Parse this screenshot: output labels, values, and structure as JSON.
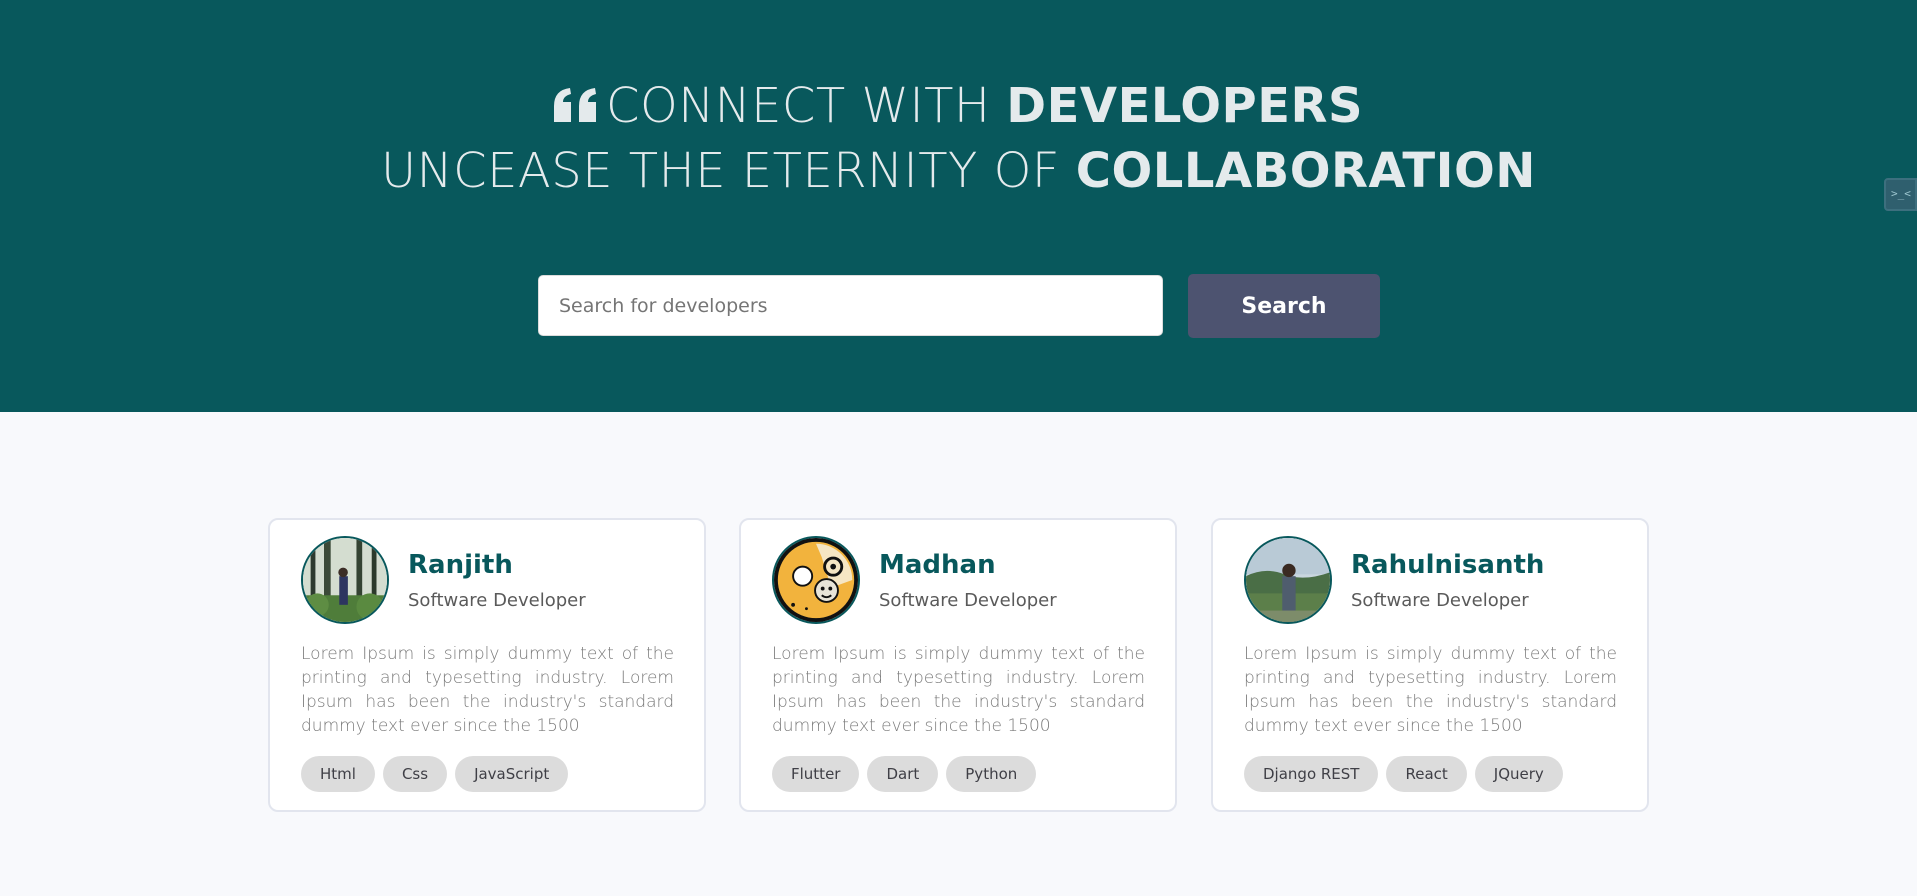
{
  "hero": {
    "line1_prefix": "CONNECT WITH",
    "line1_bold": "DEVELOPERS",
    "line2_prefix": "UNCEASE THE ETERNITY OF",
    "line2_bold": "COLLABORATION",
    "quote_icon": "quote-left-icon"
  },
  "search": {
    "placeholder": "Search for developers",
    "value": "",
    "button_label": "Search"
  },
  "side_widget": {
    "icon": "code-icon",
    "glyph": ">_<"
  },
  "developers": [
    {
      "name": "Ranjith",
      "role": "Software Developer",
      "bio": "Lorem Ipsum is simply dummy text of the printing and typesetting industry. Lorem Ipsum has been the industry's standard dummy text ever since the 1500",
      "skills": [
        "Html",
        "Css",
        "JavaScript"
      ],
      "avatar": "forest-photo-avatar"
    },
    {
      "name": "Madhan",
      "role": "Software Developer",
      "bio": "Lorem Ipsum is simply dummy text of the printing and typesetting industry. Lorem Ipsum has been the industry's standard dummy text ever since the 1500",
      "skills": [
        "Flutter",
        "Dart",
        "Python"
      ],
      "avatar": "cartoon-avatar"
    },
    {
      "name": "Rahulnisanth",
      "role": "Software Developer",
      "bio": "Lorem Ipsum is simply dummy text of the printing and typesetting industry. Lorem Ipsum has been the industry's standard dummy text ever since the 1500",
      "skills": [
        "Django REST",
        "React",
        "JQuery"
      ],
      "avatar": "landscape-photo-avatar"
    }
  ],
  "colors": {
    "hero_bg": "#08585c",
    "accent": "#08585c",
    "button_bg": "#4d5370",
    "page_bg": "#f8f9fc",
    "tag_bg": "#dcdcdc"
  }
}
